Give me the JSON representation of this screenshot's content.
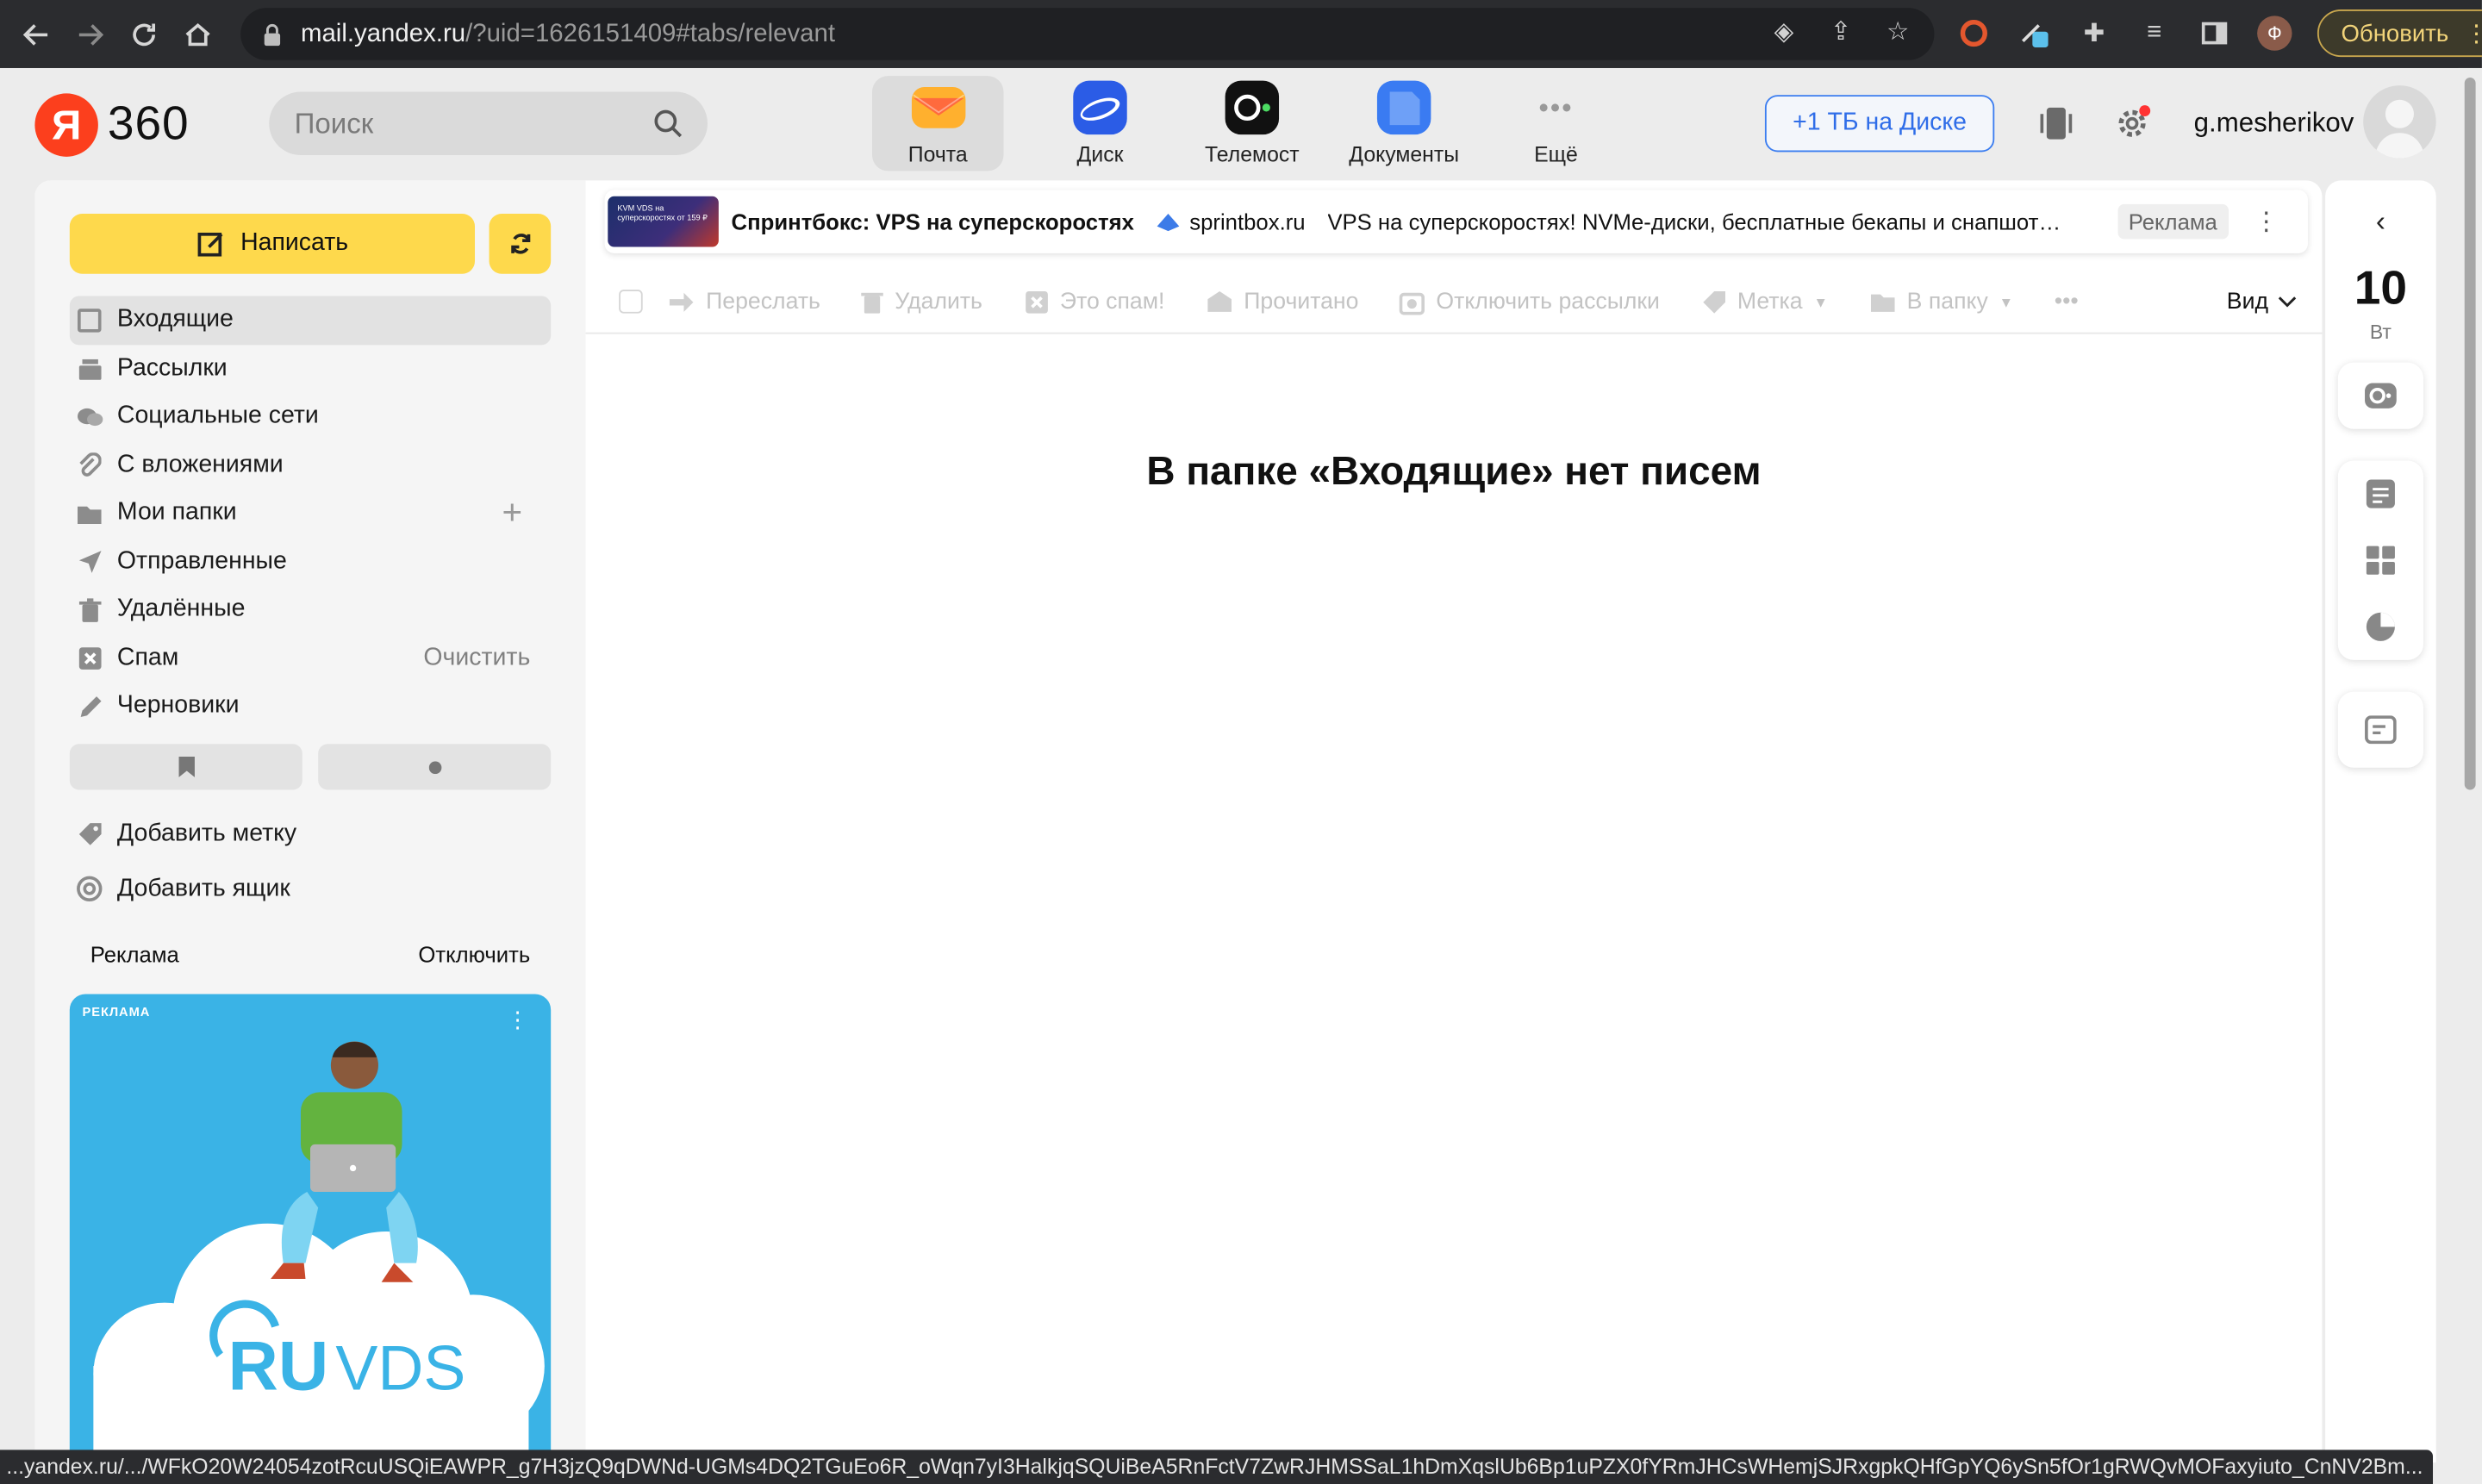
{
  "browser": {
    "url_host": "mail.yandex.ru",
    "url_path": "/?uid=1626151409#tabs/relevant",
    "update_label": "Обновить",
    "profile_initial": "Ф",
    "status_url": "...yandex.ru/.../WFkO20W24054zotRcuUSQiEAWPR_g7H3jzQ9qDWNd-UGMs4DQ2TGuEo6R_oWqn7yI3HalkjqSQUiBeA5RnFctV7ZwRJHMSSaL1hDmXqslUb6Bp1uPZX0fYRmJHCsWHemjSJRxgpkQHfGpYQ6ySn5fOr1gRWQvMOFaxyiuto_CnNV2Bm..."
  },
  "header": {
    "logo_letter": "Я",
    "logo_text": "360",
    "search_placeholder": "Поиск",
    "services": [
      {
        "label": "Почта",
        "icon": "mail-envelope-icon",
        "color": "#ffb02e",
        "active": true
      },
      {
        "label": "Диск",
        "icon": "disk-icon",
        "color": "#2b5ce6"
      },
      {
        "label": "Телемост",
        "icon": "telemost-icon",
        "color": "#111111"
      },
      {
        "label": "Документы",
        "icon": "documents-icon",
        "color": "#3a7bf2"
      },
      {
        "label": "Ещё",
        "icon": "more-dots-icon",
        "color": "#9a9a9a"
      }
    ],
    "disk_button": "+1 ТБ на Диске",
    "username": "g.mesherikov"
  },
  "sidebar": {
    "compose_label": "Написать",
    "folders": [
      {
        "label": "Входящие",
        "icon": "inbox-icon",
        "active": true
      },
      {
        "label": "Рассылки",
        "icon": "newsletters-icon"
      },
      {
        "label": "Социальные сети",
        "icon": "social-icon"
      },
      {
        "label": "С вложениями",
        "icon": "attachment-icon"
      },
      {
        "label": "Мои папки",
        "icon": "folder-icon",
        "plus": "+"
      },
      {
        "label": "Отправленные",
        "icon": "sent-icon"
      },
      {
        "label": "Удалённые",
        "icon": "trash-icon"
      },
      {
        "label": "Спам",
        "icon": "spam-icon",
        "action": "Очистить"
      },
      {
        "label": "Черновики",
        "icon": "pencil-icon"
      }
    ],
    "add_label": "Добавить метку",
    "add_mailbox": "Добавить ящик",
    "ad_title": "Реклама",
    "ad_disable": "Отключить",
    "ad_card": {
      "tag": "РЕКЛАМА",
      "brand": "RU VDS",
      "bg_color": "#3ab3e6"
    }
  },
  "banner": {
    "thumb_text": "KVM VDS на суперскоростях от 159 ₽",
    "title": "Спринтбокс: VPS на суперскоростях",
    "site": "sprintbox.ru",
    "description": "VPS на суперскоростях! NVMe-диски, бесплатные бекапы и снапшот…",
    "ad_label": "Реклама"
  },
  "toolbar": {
    "actions": [
      {
        "label": "Переслать",
        "icon": "forward-icon"
      },
      {
        "label": "Удалить",
        "icon": "delete-icon"
      },
      {
        "label": "Это спам!",
        "icon": "spam-mark-icon"
      },
      {
        "label": "Прочитано",
        "icon": "read-icon"
      },
      {
        "label": "Отключить рассылки",
        "icon": "unsubscribe-icon"
      },
      {
        "label": "Метка",
        "icon": "label-icon",
        "dropdown": true
      },
      {
        "label": "В папку",
        "icon": "move-folder-icon",
        "dropdown": true
      }
    ],
    "more": "•••",
    "view_label": "Вид"
  },
  "main": {
    "empty_message": "В папке «Входящие» нет писем"
  },
  "rail": {
    "day": "10",
    "weekday": "Вт"
  }
}
